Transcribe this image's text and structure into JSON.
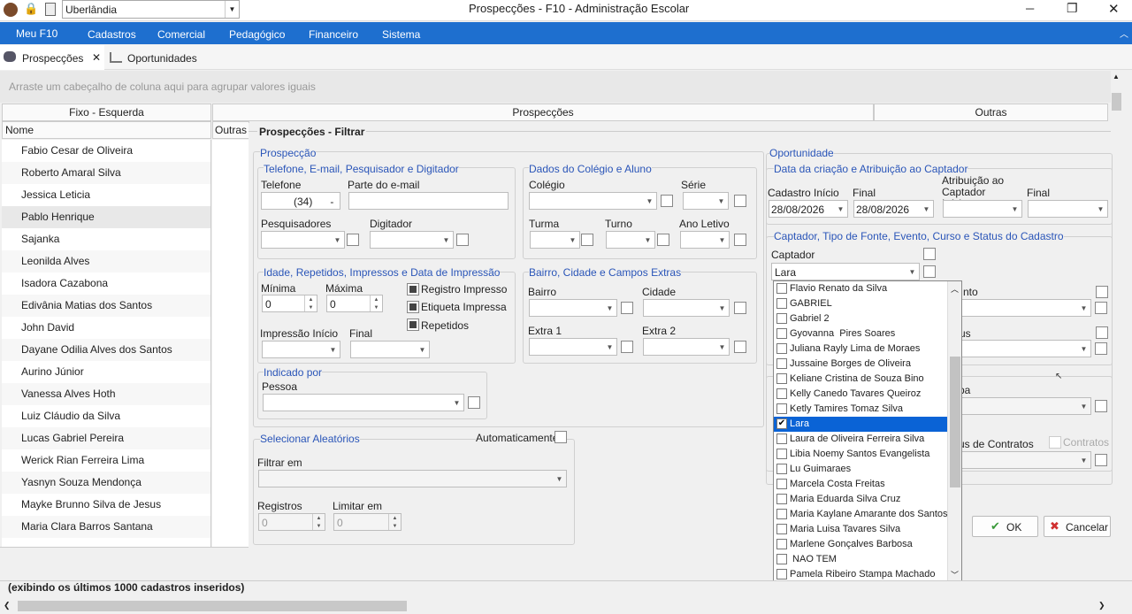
{
  "titlebar": {
    "city": "Uberlândia",
    "title": "Prospecções - F10 - Administração Escolar",
    "minimize": "─",
    "maximize": "❐",
    "close": "✕"
  },
  "menu": [
    "Meu F10",
    "Cadastros",
    "Comercial",
    "Pedagógico",
    "Financeiro",
    "Sistema"
  ],
  "tabs": [
    {
      "label": "Prospecções",
      "close": "✕"
    },
    {
      "label": "Oportunidades"
    }
  ],
  "group_hint": "Arraste um cabeçalho de coluna aqui para agrupar valores iguais",
  "grid": {
    "band_left": "Fixo - Esquerda",
    "band_mid": "Prospecções",
    "band_right": "Outras",
    "col_name": "Nome",
    "col_outras": "Outras",
    "rows": [
      "Fabio Cesar de Oliveira",
      "Roberto Amaral Silva",
      "Jessica Leticia",
      "Pablo Henrique",
      "Sajanka",
      "Leonilda Alves",
      "Isadora Cazabona",
      "Edivânia Matias dos Santos",
      "John David",
      "Dayane Odilia Alves dos Santos",
      "Aurino Júnior",
      "Vanessa Alves Hoth",
      "Luiz Cláudio da Silva",
      "Lucas Gabriel Pereira",
      "Werick Rian Ferreira Lima",
      "Yasnyn Souza Mendonça",
      "Mayke Brunno Silva de Jesus",
      "Maria Clara Barros Santana"
    ]
  },
  "filter": {
    "title": "Prospecções - Filtrar",
    "prospeccao": "Prospecção",
    "tel_group": "Telefone, E-mail, Pesquisador e Digitador",
    "telefone": "Telefone",
    "telefone_value": "(34)      -",
    "email_part": "Parte do e-mail",
    "pesquisadores": "Pesquisadores",
    "digitador": "Digitador",
    "colegio_group": "Dados do Colégio e Aluno",
    "colegio": "Colégio",
    "serie": "Série",
    "turma": "Turma",
    "turno": "Turno",
    "ano_letivo": "Ano Letivo",
    "idade_group": "Idade, Repetidos, Impressos e Data de Impressão",
    "minima": "Mínima",
    "maxima": "Máxima",
    "min_value": "0",
    "max_value": "0",
    "registro_impresso": "Registro Impresso",
    "etiqueta_impressa": "Etiqueta Impressa",
    "repetidos": "Repetidos",
    "impressao_inicio": "Impressão Início",
    "final": "Final",
    "bairro_group": "Bairro, Cidade e Campos Extras",
    "bairro": "Bairro",
    "cidade": "Cidade",
    "extra1": "Extra 1",
    "extra2": "Extra 2",
    "indicado_group": "Indicado por",
    "pessoa": "Pessoa",
    "aleatorios_group": "Selecionar Aleatórios",
    "automaticamente": "Automaticamente",
    "filtrar_em": "Filtrar em",
    "registros": "Registros",
    "limitar_em": "Limitar em",
    "reg_value": "0",
    "lim_value": "0",
    "oportunidade": "Oportunidade",
    "data_group": "Data da criação e Atribuição ao Captador",
    "cadastro_inicio": "Cadastro Início",
    "cadastro_final": "Final",
    "cadastro_inicio_value": "28/08/2026",
    "cadastro_final_value": "28/08/2026",
    "atrib_inicio": "Atribuição ao Captador Início",
    "atrib_final": "Final",
    "captador_group": "Captador, Tipo de Fonte, Evento, Curso e Status do Cadastro",
    "captador": "Captador",
    "captador_value": "Lara",
    "nto": "nto",
    "us": "us",
    "pa": "pa",
    "us_contratos": "us de Contratos",
    "contratos": "Contratos"
  },
  "dropdown": [
    "Flavio Renato da Silva",
    "GABRIEL",
    "Gabriel 2",
    "Gyovanna  Pires Soares",
    "Juliana Rayly Lima de Moraes",
    "Jussaine Borges de Oliveira",
    "Keliane Cristina de Souza Bino",
    "Kelly Canedo Tavares Queiroz",
    "Ketly Tamires Tomaz Silva",
    "Lara",
    "Laura de Oliveira Ferreira Silva",
    "Libia Noemy Santos Evangelista",
    "Lu Guimaraes",
    "Marcela Costa Freitas",
    "Maria Eduarda Silva Cruz",
    "Maria Kaylane Amarante dos Santos",
    "Maria Luisa Tavares Silva",
    "Marlene Gonçalves Barbosa",
    " NAO TEM",
    "Pamela Ribeiro Stampa Machado"
  ],
  "dropdown_selected": "Lara",
  "buttons": {
    "ok": "OK",
    "cancelar": "Cancelar"
  },
  "status": "(exibindo os últimos 1000 cadastros inseridos)",
  "colors": {
    "menu_bg": "#1e6fcf",
    "selected": "#0a63d6",
    "group_blue": "#2a55b8"
  }
}
